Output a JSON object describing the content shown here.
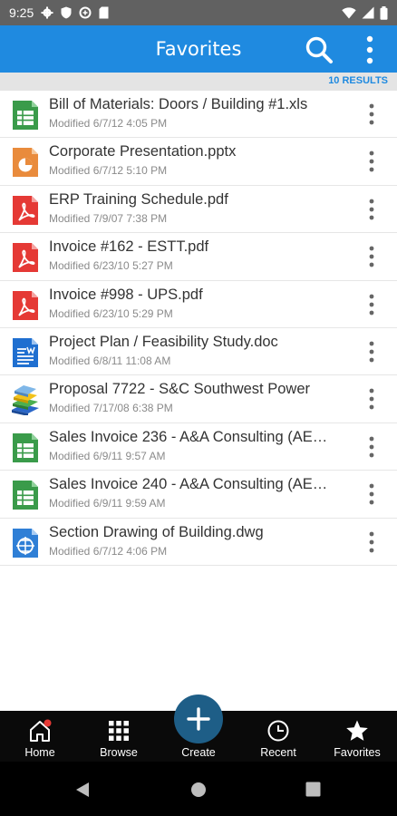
{
  "status_bar": {
    "time": "9:25"
  },
  "app_bar": {
    "title": "Favorites"
  },
  "results": {
    "label": "10 RESULTS"
  },
  "files": [
    {
      "name": "Bill of Materials: Doors / Building #1.xls",
      "modified": "Modified 6/7/12 4:05 PM",
      "icon": "spreadsheet-icon"
    },
    {
      "name": "Corporate Presentation.pptx",
      "modified": "Modified 6/7/12 5:10 PM",
      "icon": "presentation-icon"
    },
    {
      "name": "ERP Training Schedule.pdf",
      "modified": "Modified 7/9/07 7:38 PM",
      "icon": "pdf-icon"
    },
    {
      "name": "Invoice #162 - ESTT.pdf",
      "modified": "Modified 6/23/10 5:27 PM",
      "icon": "pdf-icon"
    },
    {
      "name": "Invoice #998 - UPS.pdf",
      "modified": "Modified 6/23/10 5:29 PM",
      "icon": "pdf-icon"
    },
    {
      "name": "Project Plan / Feasibility Study.doc",
      "modified": "Modified 6/8/11 11:08 AM",
      "icon": "document-icon"
    },
    {
      "name": "Proposal 7722 - S&C Southwest Power",
      "modified": "Modified 7/17/08 6:38 PM",
      "icon": "books-icon"
    },
    {
      "name": "Sales Invoice 236 - A&A Consulting (AE…",
      "modified": "Modified 6/9/11 9:57 AM",
      "icon": "spreadsheet-icon"
    },
    {
      "name": "Sales Invoice 240 - A&A Consulting (AE…",
      "modified": "Modified 6/9/11 9:59 AM",
      "icon": "spreadsheet-icon"
    },
    {
      "name": "Section Drawing of Building.dwg",
      "modified": "Modified 6/7/12 4:06 PM",
      "icon": "drawing-icon"
    }
  ],
  "bottom_nav": {
    "home": "Home",
    "browse": "Browse",
    "create": "Create",
    "recent": "Recent",
    "favorites": "Favorites"
  },
  "colors": {
    "app_bar": "#1f8ae0",
    "results_text": "#1f8ae0",
    "fab": "#1e5e87",
    "spreadsheet": "#3a9b4a",
    "presentation": "#e98b3c",
    "pdf": "#e53935",
    "document": "#1f6fd0",
    "drawing": "#2f7fd6"
  }
}
